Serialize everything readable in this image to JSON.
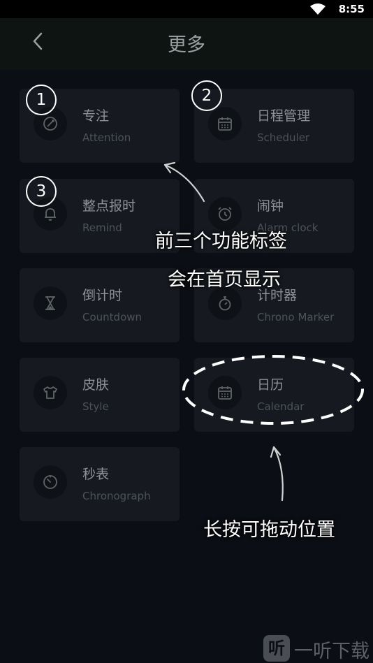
{
  "status_bar": {
    "time": "8:55",
    "wifi_icon": "wifi-icon"
  },
  "header": {
    "title": "更多",
    "back_icon": "back-arrow-icon"
  },
  "cards": [
    {
      "title": "专注",
      "subtitle": "Attention",
      "icon": "compass-icon"
    },
    {
      "title": "日程管理",
      "subtitle": "Scheduler",
      "icon": "calendar-icon"
    },
    {
      "title": "整点报时",
      "subtitle": "Remind",
      "icon": "bell-icon"
    },
    {
      "title": "闹钟",
      "subtitle": "Alarm clock",
      "icon": "alarm-clock-icon"
    },
    {
      "title": "倒计时",
      "subtitle": "Countdown",
      "icon": "hourglass-icon"
    },
    {
      "title": "计时器",
      "subtitle": "Chrono Marker",
      "icon": "stopwatch-icon"
    },
    {
      "title": "皮肤",
      "subtitle": "Style",
      "icon": "tshirt-icon"
    },
    {
      "title": "日历",
      "subtitle": "Calendar",
      "icon": "calendar-icon"
    },
    {
      "title": "秒表",
      "subtitle": "Chronograph",
      "icon": "chronograph-icon"
    }
  ],
  "annotations": {
    "numbers": [
      "1",
      "2",
      "3"
    ],
    "line1": "前三个功能标签",
    "line2": "会在首页显示",
    "line3": "长按可拖动位置"
  },
  "watermark": {
    "logo": "听",
    "text": "一听下载"
  }
}
